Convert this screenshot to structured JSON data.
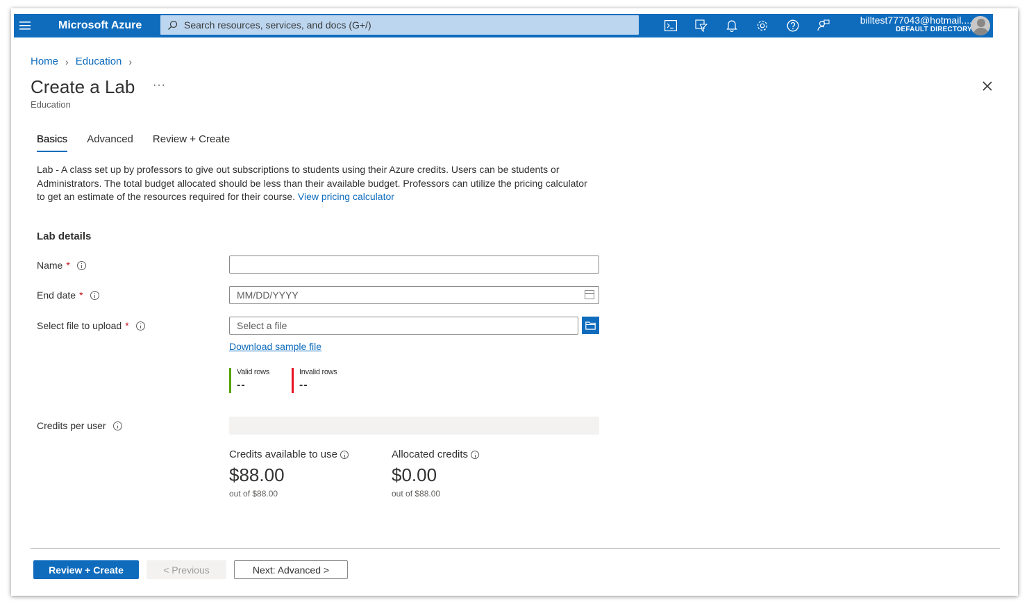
{
  "app": {
    "brand": "Microsoft Azure",
    "search_placeholder": "Search resources, services, and docs (G+/)",
    "account_email": "billtest777043@hotmail....",
    "account_directory": "DEFAULT DIRECTORY",
    "accent_color": "#0f6cbd",
    "topbar_icons": [
      "cloud-shell-icon",
      "directory-filter-icon",
      "notifications-icon",
      "settings-icon",
      "help-icon",
      "feedback-icon"
    ]
  },
  "breadcrumb": {
    "items": [
      "Home",
      "Education"
    ]
  },
  "page": {
    "title": "Create a Lab",
    "more": "···",
    "subtitle": "Education"
  },
  "tabs": [
    "Basics",
    "Advanced",
    "Review + Create"
  ],
  "active_tab": "Basics",
  "description": {
    "text": "Lab - A class set up by professors to give out subscriptions to students using their Azure credits. Users can be students or Administrators. The total budget allocated should be less than their available budget. Professors can utilize the pricing calculator to get an estimate of the resources required for their course.",
    "link": "View pricing calculator"
  },
  "form": {
    "section_title": "Lab details",
    "name_label": "Name",
    "name_value": "",
    "end_date_label": "End date",
    "end_date_placeholder": "MM/DD/YYYY",
    "file_label": "Select file to upload",
    "file_placeholder": "Select a file",
    "download_link": "Download sample file",
    "valid_rows_label": "Valid rows",
    "valid_rows_value": "--",
    "invalid_rows_label": "Invalid rows",
    "invalid_rows_value": "--",
    "credits_per_user_label": "Credits per user",
    "required_marker": "*"
  },
  "credits": {
    "available_label": "Credits available to use",
    "available_value": "$88.00",
    "available_sub": "out of $88.00",
    "allocated_label": "Allocated credits",
    "allocated_value": "$0.00",
    "allocated_sub": "out of $88.00"
  },
  "footer": {
    "review_create": "Review + Create",
    "previous": "< Previous",
    "next": "Next: Advanced >"
  }
}
